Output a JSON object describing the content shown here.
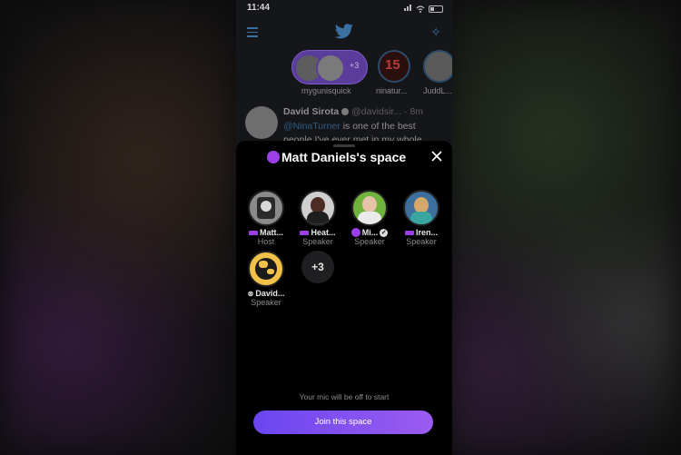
{
  "status_bar": {
    "time": "11:44"
  },
  "fleets": [
    {
      "label": "mygunisquick"
    },
    {
      "label": "ninatur..."
    },
    {
      "label": "JuddL..."
    }
  ],
  "fleet_counter": "+3",
  "fleet_number": "15",
  "tweet": {
    "author": "David Sirota",
    "handle": "@davidsir... · 8m",
    "mention": "@NinaTurner",
    "text": " is one of the best people I've ever met in my whole"
  },
  "sheet": {
    "title": "Matt Daniels's space",
    "mic_note": "Your mic will be off to start",
    "join_label": "Join this space",
    "more_count": "+3"
  },
  "speakers": [
    {
      "name": "Matt...",
      "role": "Host"
    },
    {
      "name": "Heat...",
      "role": "Speaker"
    },
    {
      "name": "Mi...",
      "role": "Speaker"
    },
    {
      "name": "Iren...",
      "role": "Speaker"
    },
    {
      "name": "David...",
      "role": "Speaker"
    }
  ],
  "colors": {
    "accent_purple": "#9b3fe6",
    "join_gradient_start": "#6a46f0",
    "join_gradient_end": "#9b5cf0",
    "twitter_blue_dim": "#3a6fa0"
  },
  "icons": [
    "location-arrow-icon",
    "signal-icon",
    "wifi-icon",
    "battery-icon",
    "menu-icon",
    "twitter-bird-icon",
    "sparkle-icon",
    "close-icon",
    "verified-icon",
    "mic-off-icon"
  ]
}
